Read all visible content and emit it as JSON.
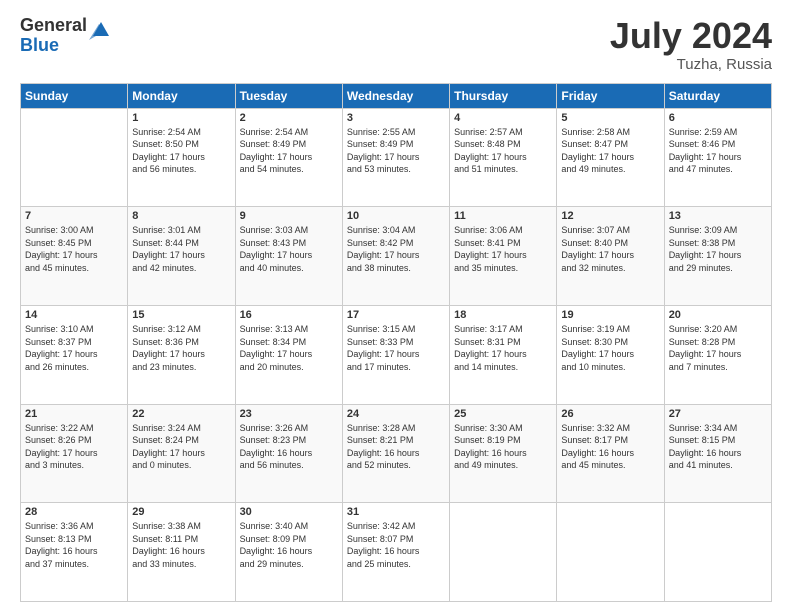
{
  "logo": {
    "general": "General",
    "blue": "Blue"
  },
  "title": "July 2024",
  "location": "Tuzha, Russia",
  "days_of_week": [
    "Sunday",
    "Monday",
    "Tuesday",
    "Wednesday",
    "Thursday",
    "Friday",
    "Saturday"
  ],
  "weeks": [
    [
      {
        "num": "",
        "info": ""
      },
      {
        "num": "1",
        "info": "Sunrise: 2:54 AM\nSunset: 8:50 PM\nDaylight: 17 hours\nand 56 minutes."
      },
      {
        "num": "2",
        "info": "Sunrise: 2:54 AM\nSunset: 8:49 PM\nDaylight: 17 hours\nand 54 minutes."
      },
      {
        "num": "3",
        "info": "Sunrise: 2:55 AM\nSunset: 8:49 PM\nDaylight: 17 hours\nand 53 minutes."
      },
      {
        "num": "4",
        "info": "Sunrise: 2:57 AM\nSunset: 8:48 PM\nDaylight: 17 hours\nand 51 minutes."
      },
      {
        "num": "5",
        "info": "Sunrise: 2:58 AM\nSunset: 8:47 PM\nDaylight: 17 hours\nand 49 minutes."
      },
      {
        "num": "6",
        "info": "Sunrise: 2:59 AM\nSunset: 8:46 PM\nDaylight: 17 hours\nand 47 minutes."
      }
    ],
    [
      {
        "num": "7",
        "info": "Sunrise: 3:00 AM\nSunset: 8:45 PM\nDaylight: 17 hours\nand 45 minutes."
      },
      {
        "num": "8",
        "info": "Sunrise: 3:01 AM\nSunset: 8:44 PM\nDaylight: 17 hours\nand 42 minutes."
      },
      {
        "num": "9",
        "info": "Sunrise: 3:03 AM\nSunset: 8:43 PM\nDaylight: 17 hours\nand 40 minutes."
      },
      {
        "num": "10",
        "info": "Sunrise: 3:04 AM\nSunset: 8:42 PM\nDaylight: 17 hours\nand 38 minutes."
      },
      {
        "num": "11",
        "info": "Sunrise: 3:06 AM\nSunset: 8:41 PM\nDaylight: 17 hours\nand 35 minutes."
      },
      {
        "num": "12",
        "info": "Sunrise: 3:07 AM\nSunset: 8:40 PM\nDaylight: 17 hours\nand 32 minutes."
      },
      {
        "num": "13",
        "info": "Sunrise: 3:09 AM\nSunset: 8:38 PM\nDaylight: 17 hours\nand 29 minutes."
      }
    ],
    [
      {
        "num": "14",
        "info": "Sunrise: 3:10 AM\nSunset: 8:37 PM\nDaylight: 17 hours\nand 26 minutes."
      },
      {
        "num": "15",
        "info": "Sunrise: 3:12 AM\nSunset: 8:36 PM\nDaylight: 17 hours\nand 23 minutes."
      },
      {
        "num": "16",
        "info": "Sunrise: 3:13 AM\nSunset: 8:34 PM\nDaylight: 17 hours\nand 20 minutes."
      },
      {
        "num": "17",
        "info": "Sunrise: 3:15 AM\nSunset: 8:33 PM\nDaylight: 17 hours\nand 17 minutes."
      },
      {
        "num": "18",
        "info": "Sunrise: 3:17 AM\nSunset: 8:31 PM\nDaylight: 17 hours\nand 14 minutes."
      },
      {
        "num": "19",
        "info": "Sunrise: 3:19 AM\nSunset: 8:30 PM\nDaylight: 17 hours\nand 10 minutes."
      },
      {
        "num": "20",
        "info": "Sunrise: 3:20 AM\nSunset: 8:28 PM\nDaylight: 17 hours\nand 7 minutes."
      }
    ],
    [
      {
        "num": "21",
        "info": "Sunrise: 3:22 AM\nSunset: 8:26 PM\nDaylight: 17 hours\nand 3 minutes."
      },
      {
        "num": "22",
        "info": "Sunrise: 3:24 AM\nSunset: 8:24 PM\nDaylight: 17 hours\nand 0 minutes."
      },
      {
        "num": "23",
        "info": "Sunrise: 3:26 AM\nSunset: 8:23 PM\nDaylight: 16 hours\nand 56 minutes."
      },
      {
        "num": "24",
        "info": "Sunrise: 3:28 AM\nSunset: 8:21 PM\nDaylight: 16 hours\nand 52 minutes."
      },
      {
        "num": "25",
        "info": "Sunrise: 3:30 AM\nSunset: 8:19 PM\nDaylight: 16 hours\nand 49 minutes."
      },
      {
        "num": "26",
        "info": "Sunrise: 3:32 AM\nSunset: 8:17 PM\nDaylight: 16 hours\nand 45 minutes."
      },
      {
        "num": "27",
        "info": "Sunrise: 3:34 AM\nSunset: 8:15 PM\nDaylight: 16 hours\nand 41 minutes."
      }
    ],
    [
      {
        "num": "28",
        "info": "Sunrise: 3:36 AM\nSunset: 8:13 PM\nDaylight: 16 hours\nand 37 minutes."
      },
      {
        "num": "29",
        "info": "Sunrise: 3:38 AM\nSunset: 8:11 PM\nDaylight: 16 hours\nand 33 minutes."
      },
      {
        "num": "30",
        "info": "Sunrise: 3:40 AM\nSunset: 8:09 PM\nDaylight: 16 hours\nand 29 minutes."
      },
      {
        "num": "31",
        "info": "Sunrise: 3:42 AM\nSunset: 8:07 PM\nDaylight: 16 hours\nand 25 minutes."
      },
      {
        "num": "",
        "info": ""
      },
      {
        "num": "",
        "info": ""
      },
      {
        "num": "",
        "info": ""
      }
    ]
  ]
}
